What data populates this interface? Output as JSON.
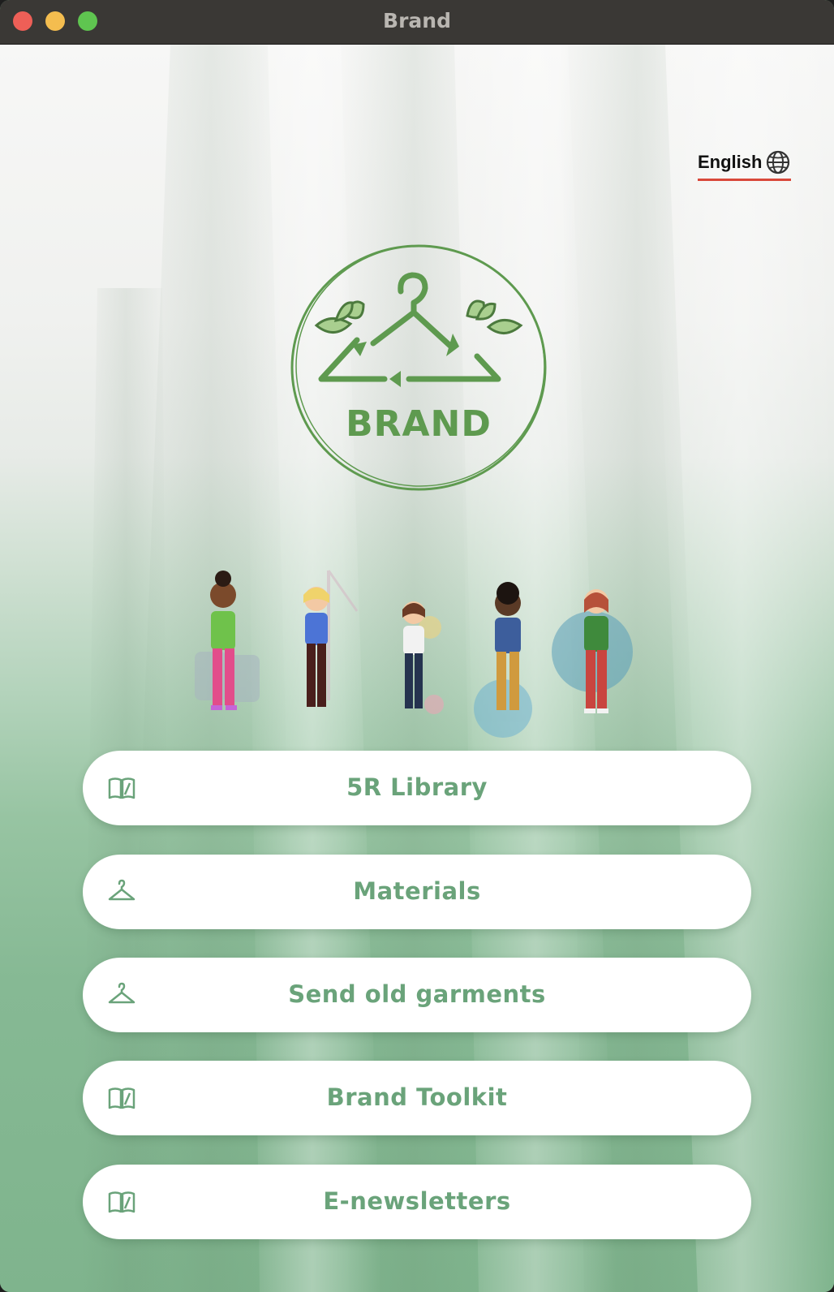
{
  "window": {
    "title": "Brand"
  },
  "language": {
    "label": "English",
    "icon": "globe-icon"
  },
  "logo": {
    "text": "BRAND",
    "color": "#5e9a4f"
  },
  "menu": [
    {
      "label": "5R Library",
      "icon": "book-icon"
    },
    {
      "label": "Materials",
      "icon": "hanger-icon"
    },
    {
      "label": "Send old garments",
      "icon": "hanger-icon"
    },
    {
      "label": "Brand Toolkit",
      "icon": "book-icon"
    },
    {
      "label": "E-newsletters",
      "icon": "book-icon"
    }
  ],
  "colors": {
    "accent": "#6aa37a",
    "underline": "#d9483a",
    "titlebar": "#3a3835"
  }
}
